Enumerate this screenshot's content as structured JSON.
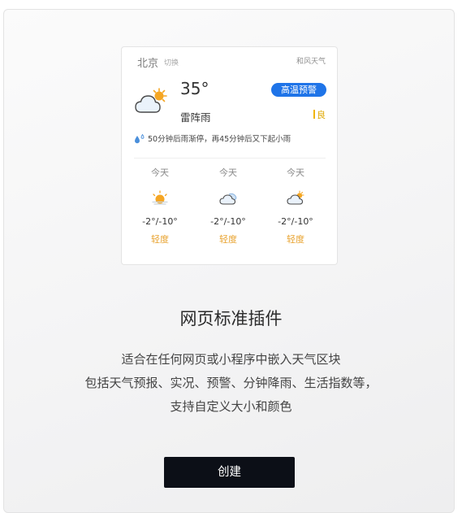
{
  "widget": {
    "city": "北京",
    "switch_label": "切换",
    "brand": "和风天气",
    "current": {
      "temperature": "35°",
      "condition": "雷阵雨",
      "icon": "cloud-sun-icon",
      "alert": "高温预警",
      "aqi": "良",
      "aqi_color": "#f0b400",
      "alert_color": "#1f74e8"
    },
    "minutely": "50分钟后雨渐停，再45分钟后又下起小雨",
    "forecast": [
      {
        "day": "今天",
        "icon": "sunny-icon",
        "temp": "-2°/-10°",
        "aqi": "轻度"
      },
      {
        "day": "今天",
        "icon": "cloud-icon",
        "temp": "-2°/-10°",
        "aqi": "轻度"
      },
      {
        "day": "今天",
        "icon": "cloud-sun-icon",
        "temp": "-2°/-10°",
        "aqi": "轻度"
      }
    ]
  },
  "headline": "网页标准插件",
  "description": [
    "适合在任何网页或小程序中嵌入天气区块",
    "包括天气预报、实况、预警、分钟降雨、生活指数等，",
    "支持自定义大小和颜色"
  ],
  "create_button": "创建"
}
